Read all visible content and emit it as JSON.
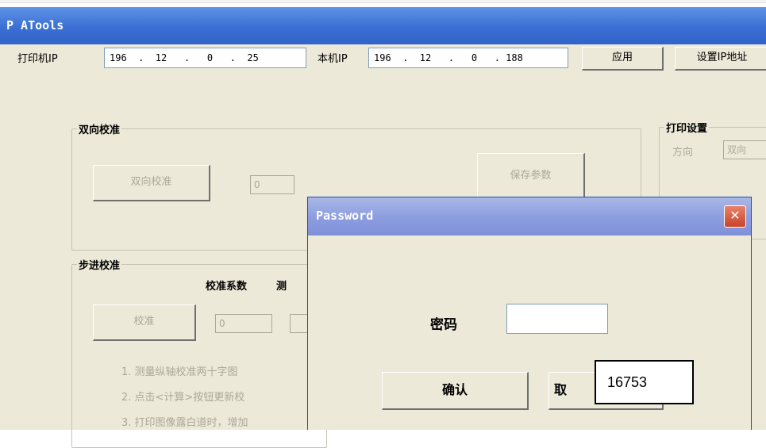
{
  "window": {
    "title": "P ATools"
  },
  "ip_bar": {
    "printer_ip_label": "打印机IP",
    "printer_ip_value": "196  .  12   .   0   .  25",
    "local_ip_label": "本机IP",
    "local_ip_value": "196  .  12   .   0   . 188",
    "apply_button": "应用",
    "set_ip_button": "设置IP地址"
  },
  "bidirectional": {
    "caption": "双向校准",
    "calibrate_button": "双向校准",
    "value": "0",
    "save_button": "保存参数"
  },
  "print_settings": {
    "caption": "打印设置",
    "direction_label": "方向",
    "direction_value": "双向"
  },
  "step": {
    "caption": "步进校准",
    "coefficient_label": "校准系数",
    "measure_label": "测",
    "calibrate_button": "校准",
    "value": "0",
    "notes": [
      "1. 测量纵轴校准两十字图",
      "2. 点击<计算>按钮更新校",
      "3. 打印图像露白道时，增加"
    ]
  },
  "password_dialog": {
    "title": "Password",
    "close_glyph": "✕",
    "password_label": "密码",
    "password_value": "",
    "confirm_button": "确认",
    "cancel_button_visible": "取"
  },
  "annotation": {
    "text": "16753"
  }
}
